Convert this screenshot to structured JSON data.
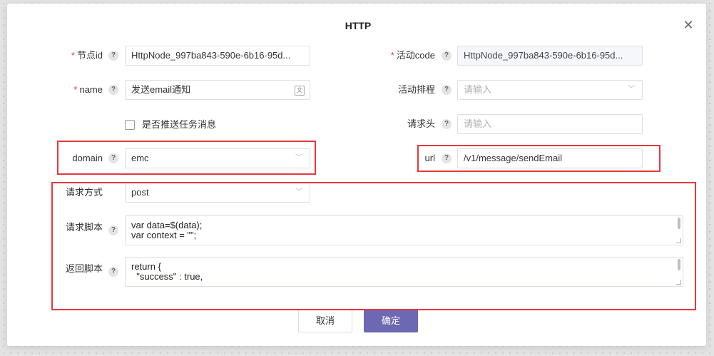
{
  "dialog": {
    "title": "HTTP",
    "close_icon": "close-icon"
  },
  "colors": {
    "required_mark": "#e5393c",
    "highlight_box": "#e5393c",
    "primary_button": "#6c68b3",
    "input_border": "#dcdfe6",
    "disabled_bg": "#f5f7fa"
  },
  "required_mark": "*",
  "help_glyph": "?",
  "fields": {
    "node_id": {
      "label": "节点id",
      "value": "HttpNode_997ba843-590e-6b16-95d..."
    },
    "activity_code": {
      "label": "活动code",
      "value": "HttpNode_997ba843-590e-6b16-95d..."
    },
    "name": {
      "label": "name",
      "value": "发送email通知"
    },
    "activity_schedule": {
      "label": "活动排程",
      "placeholder": "请输入"
    },
    "push_task_message": {
      "label": "是否推送任务消息",
      "checked": false
    },
    "request_header": {
      "label": "请求头",
      "placeholder": "请输入"
    },
    "domain": {
      "label": "domain",
      "value": "emc"
    },
    "url": {
      "label": "url",
      "value": "/v1/message/sendEmail"
    },
    "request_method": {
      "label": "请求方式",
      "value": "post"
    },
    "request_script": {
      "label": "请求脚本",
      "lines": [
        "var data=$(data);",
        "var context = \"\";"
      ]
    },
    "response_script": {
      "label": "返回脚本",
      "lines": [
        "return {",
        "  \"success\" : true,"
      ]
    }
  },
  "buttons": {
    "cancel": "取消",
    "confirm": "确定"
  }
}
